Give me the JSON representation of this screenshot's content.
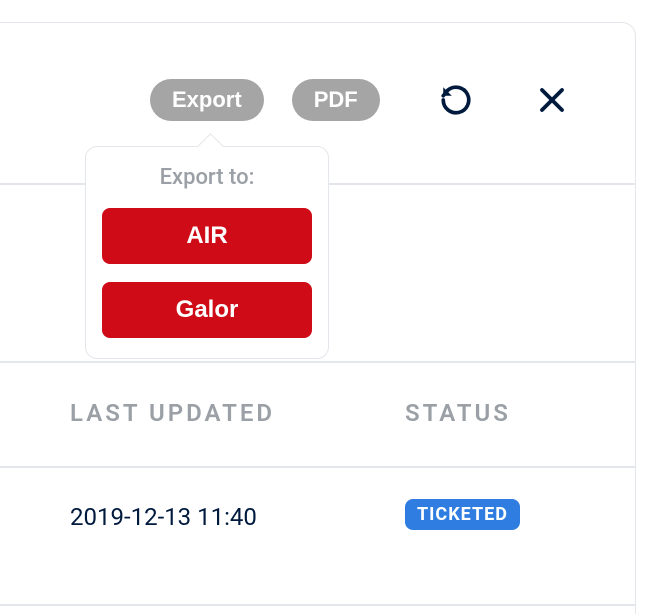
{
  "toolbar": {
    "export_label": "Export",
    "pdf_label": "PDF"
  },
  "popover": {
    "title": "Export to:",
    "options": [
      "AIR",
      "Galor"
    ]
  },
  "columns": {
    "last_updated": "LAST UPDATED",
    "status": "STATUS"
  },
  "rows": [
    {
      "last_updated": "2019-12-13 11:40",
      "status": "TICKETED"
    }
  ]
}
